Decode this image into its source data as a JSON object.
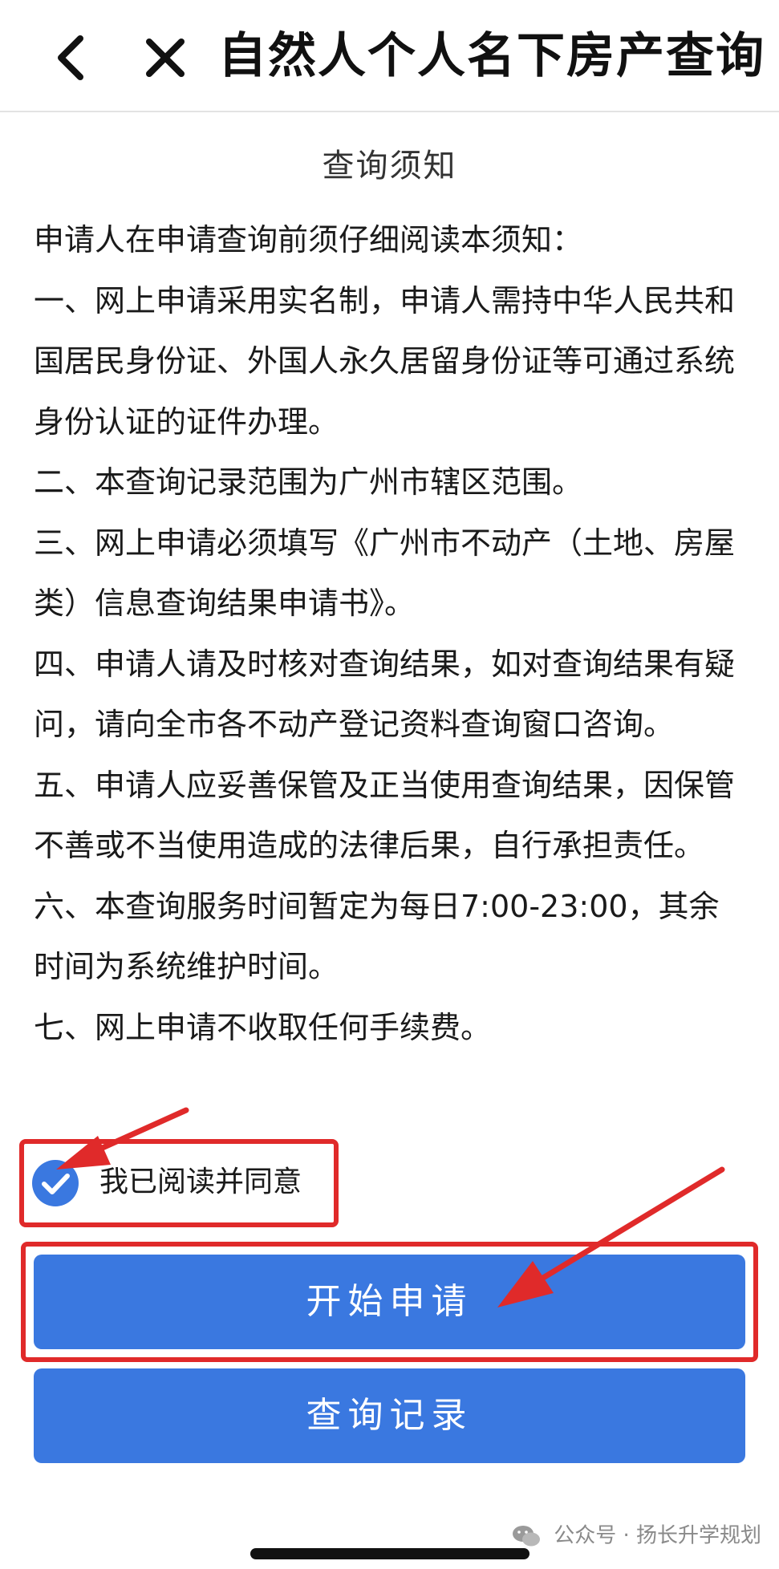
{
  "header": {
    "back_icon": "chevron-left-icon",
    "close_icon": "close-icon",
    "title": "自然人个人名下房产查询"
  },
  "notice": {
    "title": "查询须知",
    "lines": [
      "申请人在申请查询前须仔细阅读本须知：",
      "一、网上申请采用实名制，申请人需持中华人民共和国居民身份证、外国人永久居留身份证等可通过系统身份认证的证件办理。",
      "二、本查询记录范围为广州市辖区范围。",
      "三、网上申请必须填写《广州市不动产（土地、房屋类）信息查询结果申请书》。",
      "四、申请人请及时核对查询结果，如对查询结果有疑问，请向全市各不动产登记资料查询窗口咨询。",
      "五、申请人应妥善保管及正当使用查询结果，因保管不善或不当使用造成的法律后果，自行承担责任。",
      "六、本查询服务时间暂定为每日7:00-23:00，其余时间为系统维护时间。",
      "七、网上申请不收取任何手续费。"
    ]
  },
  "agreement": {
    "checked": true,
    "label": "我已阅读并同意"
  },
  "buttons": {
    "start_label": "开始申请",
    "record_label": "查询记录"
  },
  "watermark": {
    "text": "公众号 · 扬长升学规划"
  },
  "colors": {
    "primary": "#3a78e0",
    "annotation": "#e02a2a"
  }
}
